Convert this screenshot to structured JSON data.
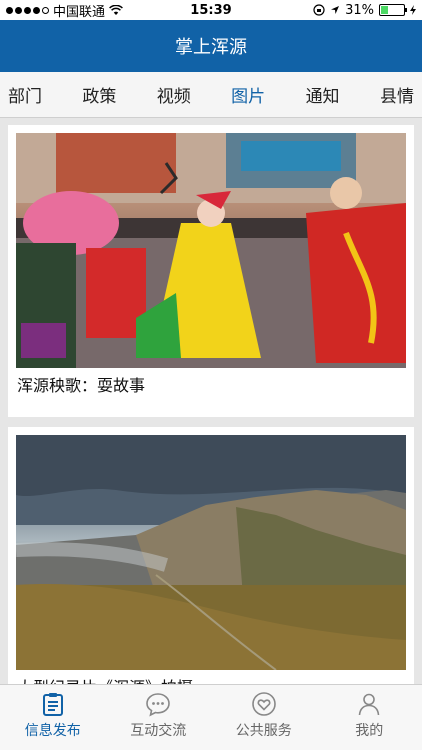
{
  "status_bar": {
    "carrier": "中国联通",
    "time": "15:39",
    "battery": "31%",
    "battery_level": 0.31
  },
  "nav": {
    "title": "掌上浑源"
  },
  "tabs": [
    {
      "label": "部门",
      "active": false
    },
    {
      "label": "政策",
      "active": false
    },
    {
      "label": "视频",
      "active": false
    },
    {
      "label": "图片",
      "active": true
    },
    {
      "label": "通知",
      "active": false
    },
    {
      "label": "县情",
      "active": false
    }
  ],
  "feed": [
    {
      "caption": "浑源秧歌：耍故事",
      "image": "yangko-dance-photo"
    },
    {
      "caption": "大型纪录片《浑源》拍摄",
      "image": "mountain-landscape-photo"
    }
  ],
  "tab_bar": [
    {
      "label": "信息发布",
      "icon": "clipboard-icon",
      "active": true
    },
    {
      "label": "互动交流",
      "icon": "chat-bubble-icon",
      "active": false
    },
    {
      "label": "公共服务",
      "icon": "heart-shield-icon",
      "active": false
    },
    {
      "label": "我的",
      "icon": "person-icon",
      "active": false
    }
  ],
  "colors": {
    "brand": "#1162a7",
    "battery": "#4cd964"
  }
}
